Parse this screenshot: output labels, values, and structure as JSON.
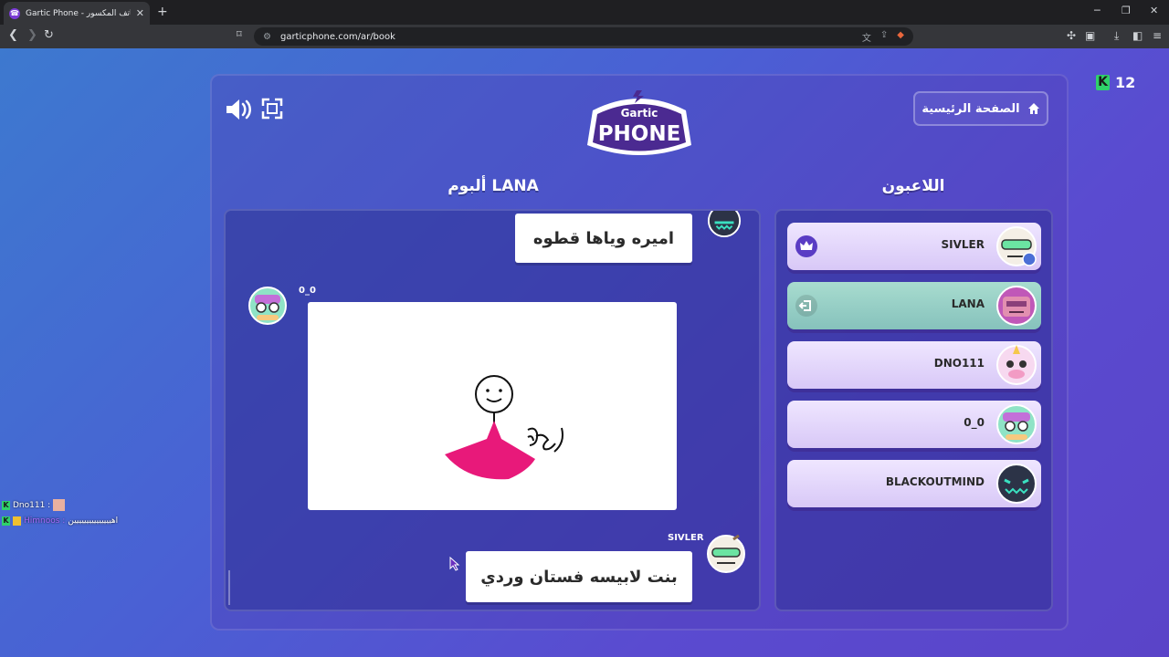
{
  "browser": {
    "tab_title": "Gartic Phone - لعبة الهاتف المكسور",
    "tab_close": "✕",
    "new_tab": "+",
    "url": "garticphone.com/ar/book",
    "minimize": "─",
    "restore": "❐",
    "close": "✕"
  },
  "game": {
    "coins": "12",
    "home_label": "الصفحة الرئيسية",
    "album_title": "ألبوم LANA",
    "players_title": "اللاعبون",
    "album": {
      "first_text": "اميره وياها قطوه",
      "drawing_author": "0_0",
      "last_author": "SIVLER",
      "last_text": "بنت لابيسه فستان وردي"
    },
    "players": [
      {
        "name": "SIVLER"
      },
      {
        "name": "LANA"
      },
      {
        "name": "DNO111"
      },
      {
        "name": "0_0"
      },
      {
        "name": "BLACKOUTMIND"
      }
    ]
  },
  "chat": [
    {
      "user": "Dno111 :",
      "message": ""
    },
    {
      "user": "Himnoos :",
      "message": "اهييييييييييييييين"
    }
  ]
}
